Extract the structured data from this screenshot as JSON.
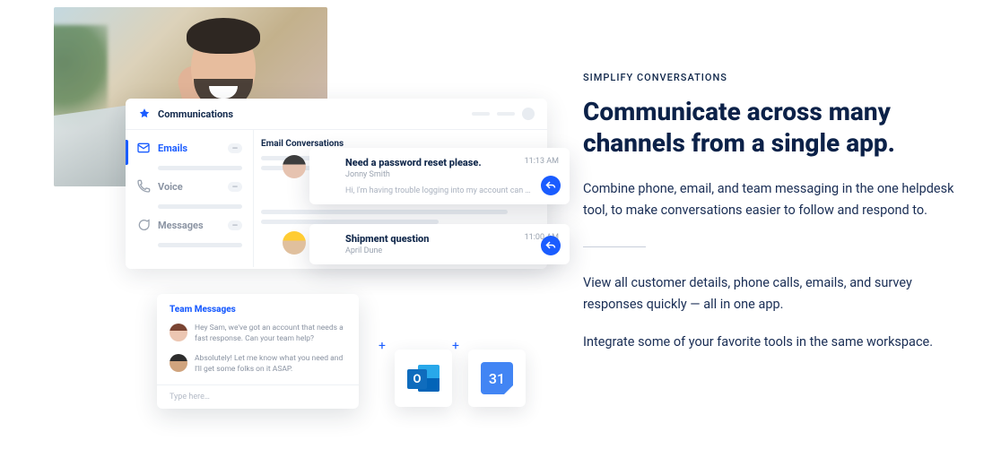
{
  "app": {
    "title": "Communications",
    "sidebar": {
      "items": [
        {
          "label": "Emails",
          "count": "—"
        },
        {
          "label": "Voice",
          "count": "—"
        },
        {
          "label": "Messages",
          "count": "—"
        }
      ]
    },
    "section_title": "Email Conversations",
    "conversations": [
      {
        "subject": "Need a password reset please.",
        "sender": "Jonny Smith",
        "preview": "Hi, I'm having trouble logging into my account can …",
        "time": "11:13 AM"
      },
      {
        "subject": "Shipment question",
        "sender": "April Dune",
        "preview": "",
        "time": "11:00 AM"
      }
    ]
  },
  "team_messages": {
    "title": "Team Messages",
    "messages": [
      "Hey Sam, we've got an account that needs a fast response. Can your team help?",
      "Absolutely! Let me know what you need and I'll get some folks on it ASAP."
    ],
    "input_placeholder": "Type here…"
  },
  "integrations": {
    "outlook_letter": "O",
    "calendar_day": "31"
  },
  "copy": {
    "eyebrow": "SIMPLIFY CONVERSATIONS",
    "headline": "Communicate across many channels from a single app.",
    "para1": "Combine phone, email, and team messaging in the one helpdesk tool, to make conversations easier to follow and respond to.",
    "para2": "View all customer details, phone calls, emails, and survey responses quickly — all in one app.",
    "para3": "Integrate some of your favorite tools in the same workspace."
  }
}
